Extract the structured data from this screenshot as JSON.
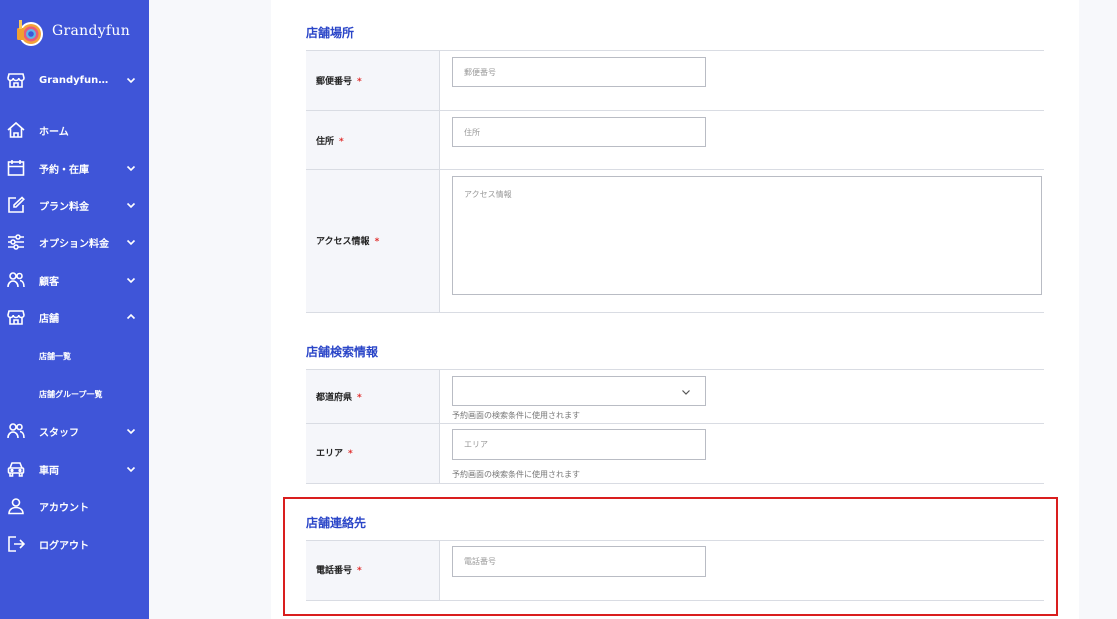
{
  "sidebar": {
    "logo_text": "Grandyfun",
    "items": [
      {
        "label": "Grandyfun…",
        "icon": "store-icon",
        "chevron": "down"
      },
      {
        "label": "ホーム",
        "icon": "home-icon",
        "chevron": ""
      },
      {
        "label": "予約・在庫",
        "icon": "calendar-icon",
        "chevron": "down"
      },
      {
        "label": "プラン料金",
        "icon": "edit-icon",
        "chevron": "down"
      },
      {
        "label": "オプション料金",
        "icon": "sliders-icon",
        "chevron": "down"
      },
      {
        "label": "顧客",
        "icon": "users-icon",
        "chevron": "down"
      },
      {
        "label": "店舗",
        "icon": "store-icon",
        "chevron": "up"
      },
      {
        "label": "スタッフ",
        "icon": "users-icon",
        "chevron": "down"
      },
      {
        "label": "車両",
        "icon": "car-icon",
        "chevron": "down"
      },
      {
        "label": "アカウント",
        "icon": "user-icon",
        "chevron": ""
      },
      {
        "label": "ログアウト",
        "icon": "logout-icon",
        "chevron": ""
      }
    ],
    "subitems": [
      "店舗一覧",
      "店舗グループ一覧"
    ]
  },
  "colors": {
    "sidebar": "#3f55d8",
    "accent": "#2b46c8",
    "required": "#e0312f",
    "highlight": "#d91e1e"
  },
  "sections": {
    "location": {
      "title": "店舗場所",
      "postal": {
        "label": "郵便番号",
        "placeholder": "郵便番号"
      },
      "address": {
        "label": "住所",
        "placeholder": "住所"
      },
      "access": {
        "label": "アクセス情報",
        "placeholder": "アクセス情報"
      }
    },
    "search": {
      "title": "店舗検索情報",
      "prefecture": {
        "label": "都道府県",
        "value": "",
        "hint": "予約画面の検索条件に使用されます"
      },
      "area": {
        "label": "エリア",
        "placeholder": "エリア",
        "hint": "予約画面の検索条件に使用されます"
      }
    },
    "contact": {
      "title": "店舗連絡先",
      "phone": {
        "label": "電話番号",
        "placeholder": "電話番号"
      }
    }
  },
  "required_mark": "*"
}
